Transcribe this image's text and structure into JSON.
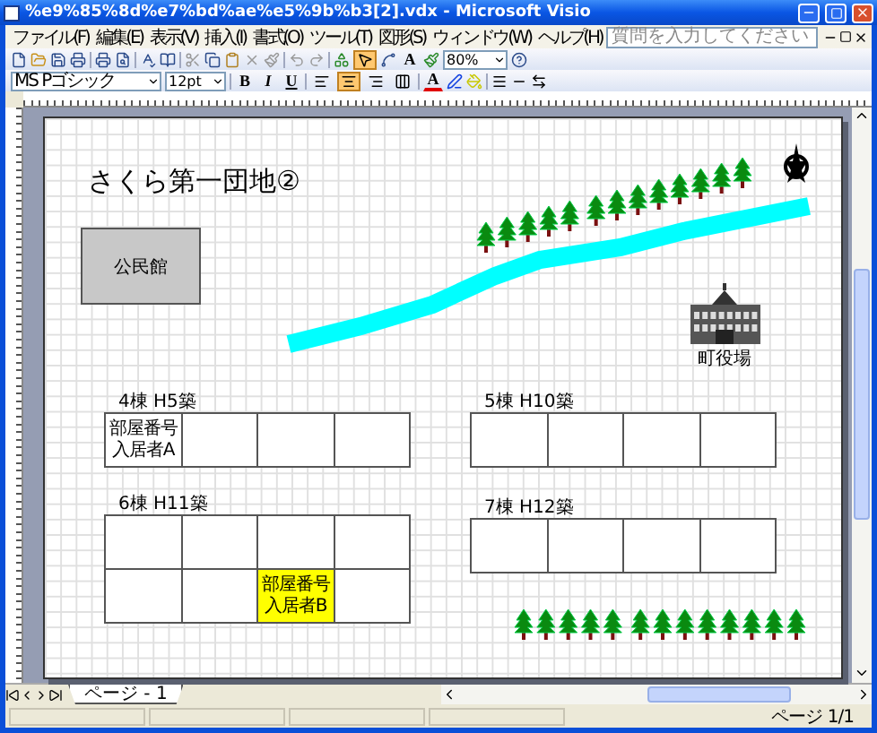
{
  "window": {
    "title": "%e9%85%8d%e7%bd%ae%e5%9b%b3[2].vdx - Microsoft Visio"
  },
  "menu": [
    "ファイル(F)",
    "編集(E)",
    "表示(V)",
    "挿入(I)",
    "書式(O)",
    "ツール(T)",
    "図形(S)",
    "ウィンドウ(W)",
    "ヘルプ(H)"
  ],
  "help_box": {
    "placeholder": "質問を入力してください"
  },
  "standard_toolbar": {
    "pointer_tool": {
      "selected": true
    },
    "text_tool": {
      "label": "A"
    },
    "zoom": "80%"
  },
  "format_toolbar": {
    "font": "MS Pゴシック",
    "size": "12pt",
    "styles": [
      "B",
      "I",
      "U"
    ],
    "alignment": [
      {
        "selected": false
      },
      {
        "selected": true
      },
      {
        "selected": false
      },
      {
        "selected": false
      }
    ],
    "font_color": {
      "label": "A"
    }
  },
  "drawing": {
    "title": "さくら第一団地②",
    "hall": "公民館",
    "town_hall_label": "町役場",
    "buildings": [
      {
        "label": "4棟 H5築",
        "rows": [
          [
            {
              "lines": [
                "部屋番号",
                "入居者A"
              ],
              "highlighted": false
            },
            {
              "highlighted": false
            },
            {
              "highlighted": false
            },
            {
              "highlighted": false
            }
          ]
        ]
      },
      {
        "label": "5棟 H10築",
        "rows": [
          [
            {
              "highlighted": false
            },
            {
              "highlighted": false
            },
            {
              "highlighted": false
            },
            {
              "highlighted": false
            }
          ]
        ]
      },
      {
        "label": "6棟 H11築",
        "rows": [
          [
            {
              "highlighted": false
            },
            {
              "highlighted": false
            },
            {
              "highlighted": false
            },
            {
              "highlighted": false
            }
          ],
          [
            {
              "highlighted": false
            },
            {
              "highlighted": false
            },
            {
              "lines": [
                "部屋番号",
                "入居者B"
              ],
              "highlighted": true
            },
            {
              "highlighted": false
            }
          ]
        ]
      },
      {
        "label": "7棟 H12築",
        "rows": [
          [
            {
              "highlighted": false
            },
            {
              "highlighted": false
            },
            {
              "highlighted": false
            },
            {
              "highlighted": false
            }
          ]
        ]
      }
    ]
  },
  "page_tabs": [
    {
      "label": "ページ - 1",
      "selected": true
    }
  ],
  "status_bar": {
    "page": "ページ 1/1"
  }
}
